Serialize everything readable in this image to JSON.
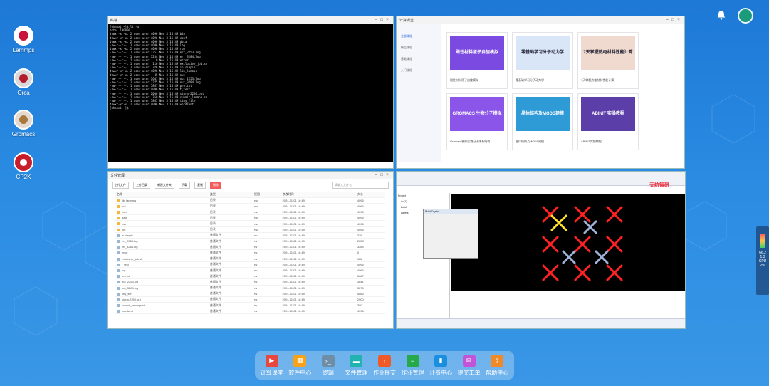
{
  "desktop": {
    "icons": [
      {
        "label": "Lammps"
      },
      {
        "label": "Orca"
      },
      {
        "label": "Gromacs"
      },
      {
        "label": "CP2K"
      }
    ]
  },
  "terminal": {
    "title": "终端",
    "lines": [
      "[shanxi ~]$ ll -a",
      "total 100000",
      "drwxr-xr-x. 2 user user 4096 Nov 3 16:49 bin",
      "drwxr-xr-x. 2 user user 4096 Nov 3 16:49 conf",
      "drwxr-xr-x. 2 user user 4096 Nov 3 16:49 data",
      "-rw-r--r--. 1 user user 4096 Nov 3 16:49 log",
      "drwxr-xr-x. 2 user user 4096 Nov 3 16:49 run",
      "-rw-r--r--. 1 user user 2253 Nov 3 16:49 err_2253.log",
      "-rw-r--r--. 1 user user 3284 Nov 3 16:49 err_3284.log",
      "-rw-r--r--. 1 user user    0 Nov 3 16:49 error",
      "-rw-r--r--. 1 user user  116 Nov 3 16:49 exclusive_job.sh",
      "-rw-r--r--. 1 user user  326 Nov 3 16:49 in.simple",
      "drwxr-xr-x. 2 user user 4096 Nov 3 16:49 lib_lammps",
      "drwxr-xr-x. 2 user user   45 Nov 3 16:49 out",
      "-rw-r--r--. 1 user user 3641 Nov 3 16:49 out_2253.log",
      "-rw-r--r--. 1 user user 3275 Nov 3 16:49 out_3284.log",
      "-rw-r--r--. 1 user user 5867 Nov 3 16:49 pro.txt",
      "-rw-r--r--. 1 user user 4096 Nov 3 16:49 t_test",
      "-rw-r--r--. 1 user user 2000 Nov 3 16:49 slurm-2250.out",
      "-rw-r--r--. 1 user user  350 Nov 3 16:49 submit_lammps.sh",
      "-rw-r--r--. 1 user user 5865 Nov 3 16:49 tiny_file",
      "drwxr-xr-x. 2 user user 4096 Nov 3 16:49 wordsent",
      "[shanxi ~]$ "
    ]
  },
  "courses": {
    "title": "计算课堂",
    "side": [
      "全部课程",
      "精品课程",
      "基础课程",
      "入门课程"
    ],
    "cards": [
      {
        "thumb": "磁性材料原子自旋模拟",
        "caption": "磁性材料原子自旋模拟",
        "color": "#7b4ae0"
      },
      {
        "thumb": "零基础学习分子动力学",
        "caption": "零基础学习分子动力学",
        "color": "#d8e6f8"
      },
      {
        "thumb": "7天掌握热电材料性能计算",
        "caption": "7天掌握热电材料性能计算",
        "color": "#f0d9cf"
      },
      {
        "thumb": "GROMACS 生物分子模拟",
        "caption": "Gromacs模拟生物分子体系结构",
        "color": "#8a55e8"
      },
      {
        "thumb": "晶体结构及MODS建模",
        "caption": "晶体结构及MODS建模",
        "color": "#2e9ad6"
      },
      {
        "thumb": "ABINIT 实操教程",
        "caption": "ABINIT实操教程",
        "color": "#5b3ea8"
      }
    ]
  },
  "filemanager": {
    "title": "文件管理",
    "toolbar": [
      "上传文件",
      "上传目录",
      "新建文件夹",
      "下载",
      "复制",
      "删除"
    ],
    "search_placeholder": "请输入文件名",
    "headers": [
      "名称",
      "类型",
      "权限",
      "修改时间",
      "大小"
    ],
    "rows": [
      [
        "lib_lammps",
        "目录",
        "rwx",
        "2024-11-01 16:49",
        "4096"
      ],
      [
        "out",
        "目录",
        "rwx",
        "2024-11-01 16:49",
        "4096"
      ],
      [
        "conf",
        "目录",
        "rwx",
        "2024-11-01 16:49",
        "4096"
      ],
      [
        "data",
        "目录",
        "rwx",
        "2024-11-01 16:49",
        "4096"
      ],
      [
        "run",
        "目录",
        "rwx",
        "2024-11-01 16:49",
        "4096"
      ],
      [
        "bin",
        "目录",
        "rwx",
        "2024-11-01 16:49",
        "4096"
      ],
      [
        "in.simple",
        "普通文件",
        "rw",
        "2024-11-01 16:49",
        "326"
      ],
      [
        "err_2253.log",
        "普通文件",
        "rw",
        "2024-11-01 16:49",
        "2253"
      ],
      [
        "err_3284.log",
        "普通文件",
        "rw",
        "2024-11-01 16:49",
        "3284"
      ],
      [
        "error",
        "普通文件",
        "rw",
        "2024-11-01 16:49",
        "0"
      ],
      [
        "exclusive_job.sh",
        "普通文件",
        "rw",
        "2024-11-01 16:49",
        "116"
      ],
      [
        "t_test",
        "普通文件",
        "rw",
        "2024-11-01 16:49",
        "4096"
      ],
      [
        "log",
        "普通文件",
        "rw",
        "2024-11-01 16:49",
        "4096"
      ],
      [
        "pro.txt",
        "普通文件",
        "rw",
        "2024-11-01 16:49",
        "5867"
      ],
      [
        "out_2253.log",
        "普通文件",
        "rw",
        "2024-11-01 16:49",
        "3641"
      ],
      [
        "out_3284.log",
        "普通文件",
        "rw",
        "2024-11-01 16:49",
        "3275"
      ],
      [
        "tiny_file",
        "普通文件",
        "rw",
        "2024-11-01 16:49",
        "5865"
      ],
      [
        "slurm-2250.out",
        "普通文件",
        "rw",
        "2024-11-01 16:49",
        "2000"
      ],
      [
        "submit_lammps.sh",
        "普通文件",
        "rw",
        "2024-11-01 16:49",
        "350"
      ],
      [
        "wordsent",
        "普通文件",
        "rw",
        "2024-11-01 16:49",
        "4096"
      ]
    ]
  },
  "ms": {
    "brand": "天航智研",
    "dialog_title": "Build Crystal",
    "tree": [
      "Project",
      "Au(1)",
      "Build",
      "Layers"
    ]
  },
  "meter": {
    "value1": "66.2",
    "value2": "1.3",
    "label": "CPU",
    "cpu": "2%"
  },
  "dock": [
    {
      "label": "计算课堂",
      "color": "#e8473f",
      "glyph": "▶"
    },
    {
      "label": "软件中心",
      "color": "#f6a21b",
      "glyph": "▦"
    },
    {
      "label": "终端",
      "color": "#6e8ea8",
      "glyph": "›_"
    },
    {
      "label": "文件管理",
      "color": "#21b3b0",
      "glyph": "▬"
    },
    {
      "label": "作业提交",
      "color": "#f05a28",
      "glyph": "↑"
    },
    {
      "label": "作业管理",
      "color": "#26a94b",
      "glyph": "≡"
    },
    {
      "label": "计费中心",
      "color": "#1a8fe0",
      "glyph": "▮"
    },
    {
      "label": "提交工单",
      "color": "#c254d8",
      "glyph": "✉"
    },
    {
      "label": "帮助中心",
      "color": "#f08a28",
      "glyph": "?"
    }
  ]
}
